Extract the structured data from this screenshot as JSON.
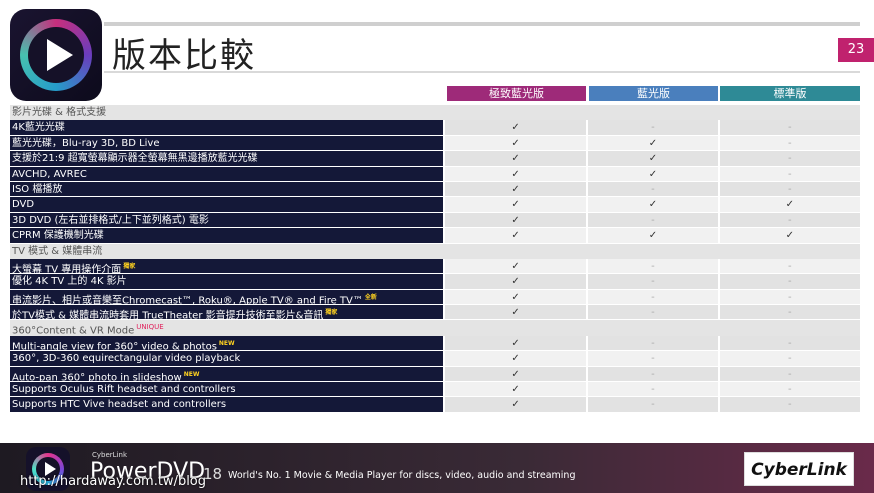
{
  "title": "版本比較",
  "page_number": "23",
  "columns": [
    "極致藍光版",
    "藍光版",
    "標準版"
  ],
  "rows": [
    {
      "type": "section",
      "label": "影片光碟 & 格式支援"
    },
    {
      "type": "feature",
      "label": "4K藍光光碟",
      "tag": "",
      "vals": [
        "✓",
        "-",
        "-"
      ]
    },
    {
      "type": "feature",
      "label": "藍光光碟，Blu-ray 3D, BD Live",
      "tag": "",
      "vals": [
        "✓",
        "✓",
        "-"
      ]
    },
    {
      "type": "feature",
      "label": "支援於21:9 超寬螢幕顯示器全螢幕無黑邊播放藍光光碟",
      "tag": "",
      "vals": [
        "✓",
        "✓",
        "-"
      ]
    },
    {
      "type": "feature",
      "label": "AVCHD, AVREC",
      "tag": "",
      "vals": [
        "✓",
        "✓",
        "-"
      ]
    },
    {
      "type": "feature",
      "label": "ISO 檔播放",
      "tag": "",
      "vals": [
        "✓",
        "-",
        "-"
      ]
    },
    {
      "type": "feature",
      "label": "DVD",
      "tag": "",
      "vals": [
        "✓",
        "✓",
        "✓"
      ]
    },
    {
      "type": "feature",
      "label": "3D DVD (左右並排格式/上下並列格式) 電影",
      "tag": "",
      "vals": [
        "✓",
        "-",
        "-"
      ]
    },
    {
      "type": "feature",
      "label": "CPRM 保護機制光碟",
      "tag": "",
      "vals": [
        "✓",
        "✓",
        "✓"
      ]
    },
    {
      "type": "section",
      "label": "TV 模式 & 媒體串流"
    },
    {
      "type": "feature",
      "label": "大螢幕 TV 專用操作介面",
      "tag": "獨家",
      "vals": [
        "✓",
        "-",
        "-"
      ]
    },
    {
      "type": "feature",
      "label": "優化 4K TV 上的 4K 影片",
      "tag": "",
      "vals": [
        "✓",
        "-",
        "-"
      ]
    },
    {
      "type": "feature",
      "label": "串流影片、相片或音樂至Chromecast™, Roku®, Apple TV® and Fire TV™",
      "tag": "全新",
      "vals": [
        "✓",
        "-",
        "-"
      ]
    },
    {
      "type": "feature",
      "label": "於TV模式 & 媒體串流時套用 TrueTheater 影音提升技術至影片&音訊",
      "tag": "獨家",
      "vals": [
        "✓",
        "-",
        "-"
      ]
    },
    {
      "type": "section",
      "label": "360°Content & VR Mode",
      "tag": "UNIQUE"
    },
    {
      "type": "feature",
      "label": "Multi-angle view for 360° video & photos",
      "tag": "NEW",
      "vals": [
        "✓",
        "-",
        "-"
      ]
    },
    {
      "type": "feature",
      "label": "360°, 3D-360 equirectangular video playback",
      "tag": "",
      "vals": [
        "✓",
        "-",
        "-"
      ]
    },
    {
      "type": "feature",
      "label": "Auto-pan 360° photo in slideshow",
      "tag": "NEW",
      "vals": [
        "✓",
        "-",
        "-"
      ]
    },
    {
      "type": "feature",
      "label": "Supports Oculus Rift headset and controllers",
      "tag": "",
      "vals": [
        "✓",
        "-",
        "-"
      ]
    },
    {
      "type": "feature",
      "label": "Supports HTC Vive headset and controllers",
      "tag": "",
      "vals": [
        "✓",
        "-",
        "-"
      ]
    }
  ],
  "footer": {
    "brand_small": "CyberLink",
    "brand": "PowerDVD",
    "version": "18",
    "tagline": "World's No. 1 Movie & Media Player for discs, video, audio and streaming",
    "company": "CyberLink",
    "url": "http://hardaway.com.tw/blog"
  }
}
